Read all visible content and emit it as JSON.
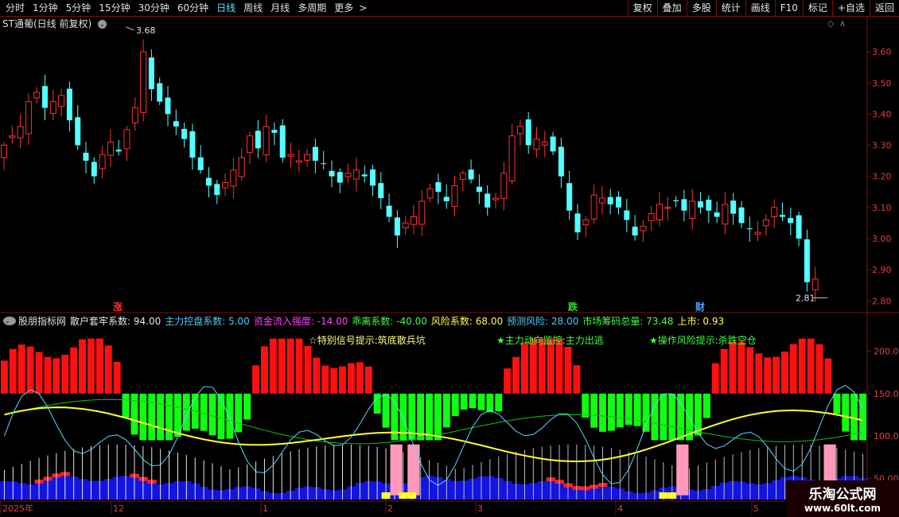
{
  "toolbar": {
    "periods": [
      "分时",
      "1分钟",
      "5分钟",
      "15分钟",
      "30分钟",
      "60分钟",
      "日线",
      "周线",
      "月线",
      "多周期",
      "更多"
    ],
    "active_period": "日线",
    "more_arrow": ">",
    "right_buttons": [
      "复权",
      "叠加",
      "多股",
      "统计",
      "画线",
      "F10",
      "标记",
      "+自选",
      "返回"
    ]
  },
  "main_chart": {
    "title": "ST通葡(日线 前复权)",
    "high_label": "3.68",
    "low_label": "2.81",
    "price_ticks": [
      "3.60",
      "3.50",
      "3.40",
      "3.30",
      "3.20",
      "3.10",
      "3.00",
      "2.90",
      "2.80"
    ],
    "price_range": [
      2.77,
      3.7
    ],
    "markers": [
      {
        "text": "涨",
        "color": "#ff3030"
      },
      {
        "text": "跌",
        "color": "#30e030"
      },
      {
        "text": "财",
        "color": "#4da6ff"
      }
    ],
    "up_color": "#ff3030",
    "down_color": "#54ffff"
  },
  "indicator": {
    "name": "股朋指标网",
    "params": [
      {
        "label": "散户套牢系数:",
        "value": "94.00",
        "color": "#e6e6e6"
      },
      {
        "label": "主力控盘系数:",
        "value": "5.00",
        "color": "#4dc8ff"
      },
      {
        "label": "资金流入强度:",
        "value": "-14.00",
        "color": "#ff40ff"
      },
      {
        "label": "乖离系数:",
        "value": "-40.00",
        "color": "#40ff40"
      },
      {
        "label": "风险系数:",
        "value": "68.00",
        "color": "#ffff40"
      },
      {
        "label": "预测风险:",
        "value": "28.00",
        "color": "#4dc8ff"
      },
      {
        "label": "市场筹码总量:",
        "value": "73.48",
        "color": "#40ff40"
      },
      {
        "label": "上市:",
        "value": "0.93",
        "color": "#ffff40"
      }
    ],
    "signals": [
      {
        "text": "☆特别信号提示:筑底散兵坑",
        "color": "#ffff80"
      },
      {
        "text": "★主力动向监控:主力出逃",
        "color": "#40ff40"
      },
      {
        "text": "★操作风险提示:杀跌空仓",
        "color": "#40ff40"
      }
    ],
    "value_ticks": [
      "200.0",
      "150.0",
      "100.0",
      "50.00"
    ],
    "value_range": [
      25,
      225
    ]
  },
  "date_axis": {
    "labels": [
      "2025年",
      "12",
      "1",
      "2",
      "3",
      "4",
      "5"
    ]
  },
  "watermark": {
    "title": "乐淘公式网",
    "url": "www.60lt.com"
  }
}
